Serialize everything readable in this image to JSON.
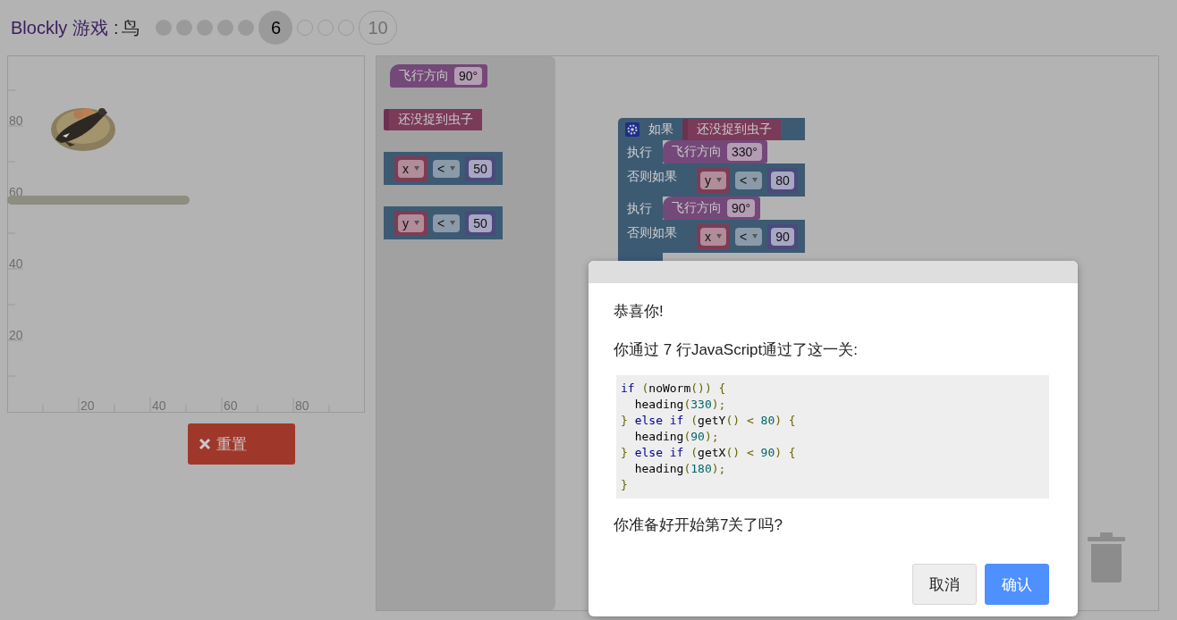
{
  "header": {
    "app_name": "Blockly 游戏",
    "separator": ":",
    "game_name": "鸟"
  },
  "levels": [
    {
      "done": true
    },
    {
      "done": true
    },
    {
      "done": true
    },
    {
      "done": true
    },
    {
      "done": true
    },
    {
      "selected": true,
      "label": "6"
    },
    {
      "done": false
    },
    {
      "done": false
    },
    {
      "done": false
    },
    {
      "selected": false,
      "label": "10"
    }
  ],
  "game_canvas": {
    "y_labels": [
      "80",
      "60",
      "40",
      "20"
    ],
    "x_labels": [
      "20",
      "40",
      "60",
      "80"
    ]
  },
  "reset_button": {
    "label": "重置"
  },
  "toolbox": {
    "blocks": [
      {
        "kind": "heading",
        "label": "飞行方向",
        "value": "90°"
      },
      {
        "kind": "condition",
        "label": "还没捉到虫子"
      },
      {
        "kind": "compare",
        "variable": "x",
        "operator": "<",
        "value": "50"
      },
      {
        "kind": "compare",
        "variable": "y",
        "operator": "<",
        "value": "50"
      }
    ]
  },
  "workspace": {
    "if_block": {
      "rows": [
        {
          "kind": "if",
          "label": "如果",
          "input": {
            "kind": "condition",
            "label": "还没捉到虫子"
          }
        },
        {
          "kind": "do",
          "label": "执行",
          "input": {
            "kind": "heading",
            "label": "飞行方向",
            "value": "330°"
          }
        },
        {
          "kind": "elseif",
          "label": "否则如果",
          "input": {
            "kind": "compare",
            "variable": "y",
            "operator": "<",
            "value": "80"
          }
        },
        {
          "kind": "do",
          "label": "执行",
          "input": {
            "kind": "heading",
            "label": "飞行方向",
            "value": "90°"
          }
        },
        {
          "kind": "elseif",
          "label": "否则如果",
          "input": {
            "kind": "compare",
            "variable": "x",
            "operator": "<",
            "value": "90"
          }
        }
      ]
    }
  },
  "dialog": {
    "title": "恭喜你!",
    "message": "你通过 7 行JavaScript通过了这一关:",
    "code_lines": [
      [
        {
          "kind": "keyword",
          "text": "if"
        },
        {
          "kind": "punct",
          "text": " ("
        },
        {
          "kind": "plain",
          "text": "noWorm"
        },
        {
          "kind": "punct",
          "text": "()) {"
        }
      ],
      [
        {
          "kind": "plain",
          "text": "  heading"
        },
        {
          "kind": "punct",
          "text": "("
        },
        {
          "kind": "number",
          "text": "330"
        },
        {
          "kind": "punct",
          "text": ");"
        }
      ],
      [
        {
          "kind": "punct",
          "text": "} "
        },
        {
          "kind": "keyword",
          "text": "else if"
        },
        {
          "kind": "punct",
          "text": " ("
        },
        {
          "kind": "plain",
          "text": "getY"
        },
        {
          "kind": "punct",
          "text": "() < "
        },
        {
          "kind": "number",
          "text": "80"
        },
        {
          "kind": "punct",
          "text": ") {"
        }
      ],
      [
        {
          "kind": "plain",
          "text": "  heading"
        },
        {
          "kind": "punct",
          "text": "("
        },
        {
          "kind": "number",
          "text": "90"
        },
        {
          "kind": "punct",
          "text": ");"
        }
      ],
      [
        {
          "kind": "punct",
          "text": "} "
        },
        {
          "kind": "keyword",
          "text": "else if"
        },
        {
          "kind": "punct",
          "text": " ("
        },
        {
          "kind": "plain",
          "text": "getX"
        },
        {
          "kind": "punct",
          "text": "() < "
        },
        {
          "kind": "number",
          "text": "90"
        },
        {
          "kind": "punct",
          "text": ") {"
        }
      ],
      [
        {
          "kind": "plain",
          "text": "  heading"
        },
        {
          "kind": "punct",
          "text": "("
        },
        {
          "kind": "number",
          "text": "180"
        },
        {
          "kind": "punct",
          "text": ");"
        }
      ],
      [
        {
          "kind": "punct",
          "text": "}"
        }
      ]
    ],
    "question": "你准备好开始第7关了吗?",
    "buttons": [
      {
        "kind": "secondary",
        "label": "取消"
      },
      {
        "kind": "primary",
        "label": "确认"
      }
    ]
  }
}
